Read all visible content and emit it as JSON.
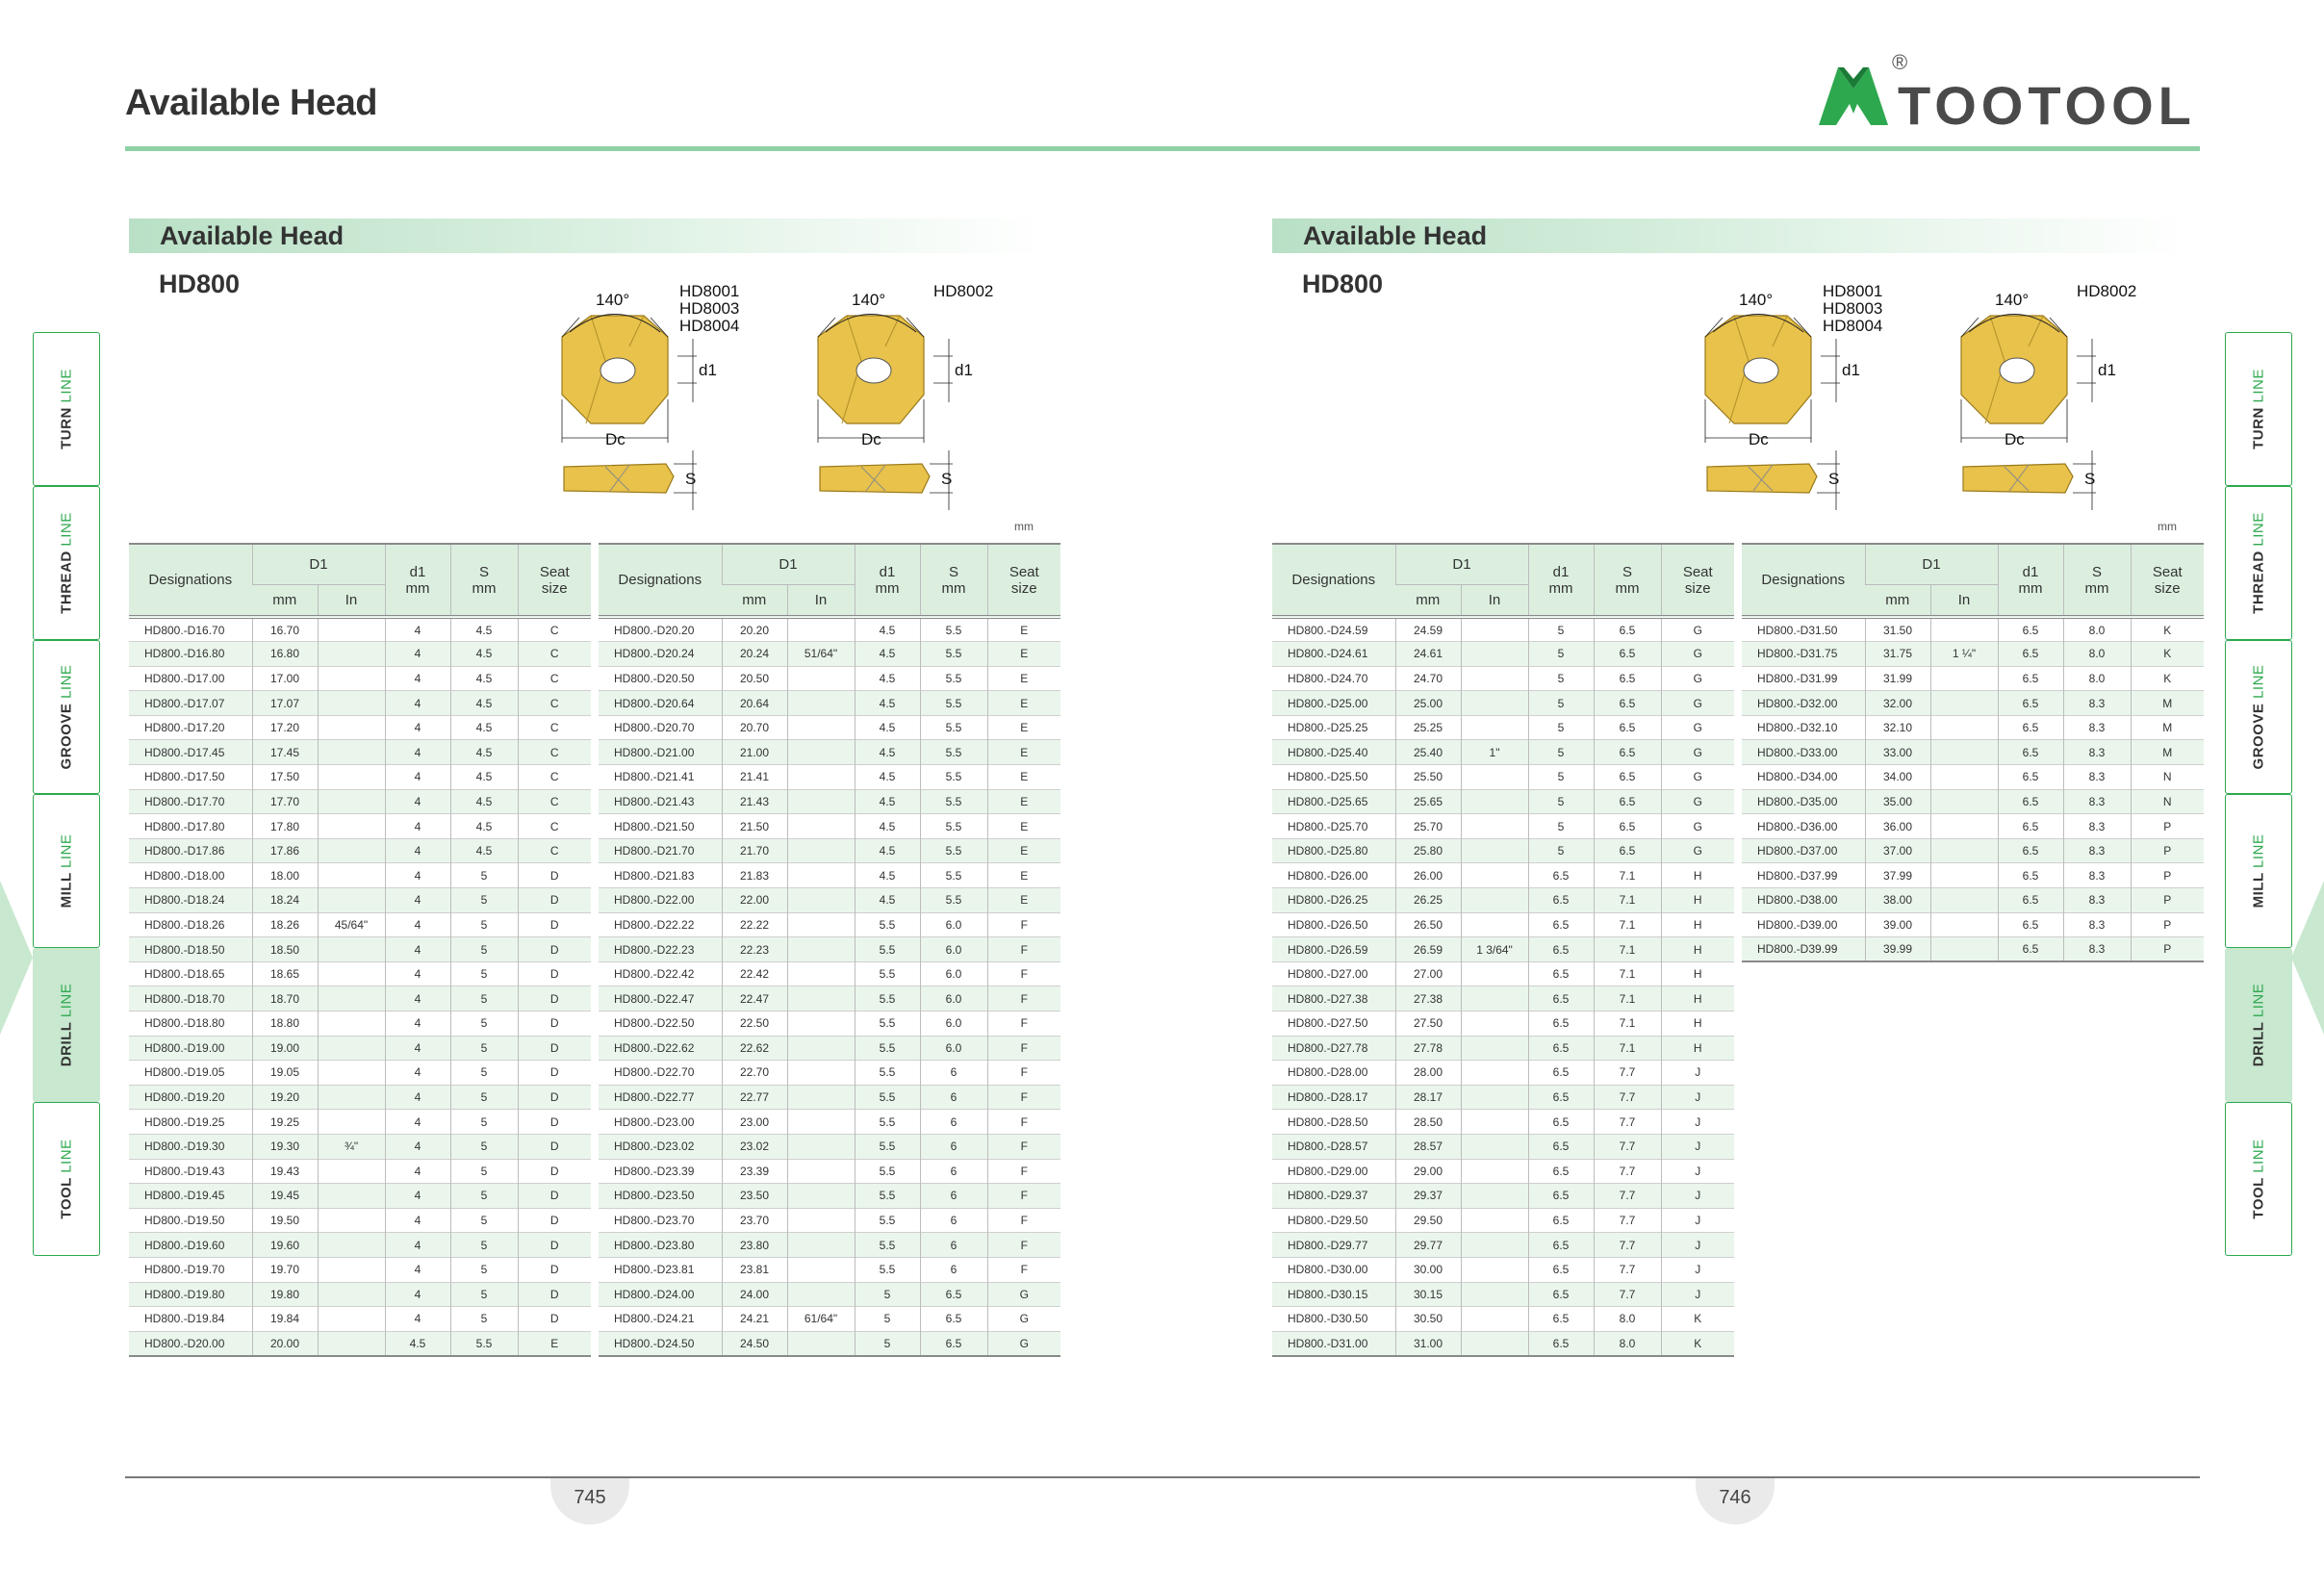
{
  "header": {
    "title": "Available Head",
    "brand": "TOOTOOL",
    "registered": "®"
  },
  "side_tabs": [
    {
      "main": "TURN",
      "sub": "LINE",
      "active": false
    },
    {
      "main": "THREAD",
      "sub": "LINE",
      "active": false
    },
    {
      "main": "GROOVE",
      "sub": "LINE",
      "active": false
    },
    {
      "main": "MILL",
      "sub": "LINE",
      "active": false
    },
    {
      "main": "DRILL",
      "sub": "LINE",
      "active": true
    },
    {
      "main": "TOOL",
      "sub": "LINE",
      "active": false
    }
  ],
  "figure": {
    "angle": "140°",
    "captions_a": [
      "HD8001",
      "HD8003",
      "HD8004"
    ],
    "caption_b": "HD8002",
    "label_d1": "d1",
    "label_dc": "Dc",
    "label_s": "S"
  },
  "table_headers": {
    "designations": "Designations",
    "d1_group": "D1",
    "mm": "mm",
    "in": "In",
    "d1": "d1",
    "d1_unit": "mm",
    "s": "S",
    "s_unit": "mm",
    "seat": "Seat",
    "seat2": "size"
  },
  "pages": [
    {
      "banner": "Available Head",
      "series": "HD800",
      "unit_note": "mm",
      "page_number": "745",
      "tables": [
        {
          "rows": [
            [
              "HD800.-D16.70",
              "16.70",
              "",
              "4",
              "4.5",
              "C"
            ],
            [
              "HD800.-D16.80",
              "16.80",
              "",
              "4",
              "4.5",
              "C"
            ],
            [
              "HD800.-D17.00",
              "17.00",
              "",
              "4",
              "4.5",
              "C"
            ],
            [
              "HD800.-D17.07",
              "17.07",
              "",
              "4",
              "4.5",
              "C"
            ],
            [
              "HD800.-D17.20",
              "17.20",
              "",
              "4",
              "4.5",
              "C"
            ],
            [
              "HD800.-D17.45",
              "17.45",
              "",
              "4",
              "4.5",
              "C"
            ],
            [
              "HD800.-D17.50",
              "17.50",
              "",
              "4",
              "4.5",
              "C"
            ],
            [
              "HD800.-D17.70",
              "17.70",
              "",
              "4",
              "4.5",
              "C"
            ],
            [
              "HD800.-D17.80",
              "17.80",
              "",
              "4",
              "4.5",
              "C"
            ],
            [
              "HD800.-D17.86",
              "17.86",
              "",
              "4",
              "4.5",
              "C"
            ],
            [
              "HD800.-D18.00",
              "18.00",
              "",
              "4",
              "5",
              "D"
            ],
            [
              "HD800.-D18.24",
              "18.24",
              "",
              "4",
              "5",
              "D"
            ],
            [
              "HD800.-D18.26",
              "18.26",
              "45/64\"",
              "4",
              "5",
              "D"
            ],
            [
              "HD800.-D18.50",
              "18.50",
              "",
              "4",
              "5",
              "D"
            ],
            [
              "HD800.-D18.65",
              "18.65",
              "",
              "4",
              "5",
              "D"
            ],
            [
              "HD800.-D18.70",
              "18.70",
              "",
              "4",
              "5",
              "D"
            ],
            [
              "HD800.-D18.80",
              "18.80",
              "",
              "4",
              "5",
              "D"
            ],
            [
              "HD800.-D19.00",
              "19.00",
              "",
              "4",
              "5",
              "D"
            ],
            [
              "HD800.-D19.05",
              "19.05",
              "",
              "4",
              "5",
              "D"
            ],
            [
              "HD800.-D19.20",
              "19.20",
              "",
              "4",
              "5",
              "D"
            ],
            [
              "HD800.-D19.25",
              "19.25",
              "",
              "4",
              "5",
              "D"
            ],
            [
              "HD800.-D19.30",
              "19.30",
              "¾\"",
              "4",
              "5",
              "D"
            ],
            [
              "HD800.-D19.43",
              "19.43",
              "",
              "4",
              "5",
              "D"
            ],
            [
              "HD800.-D19.45",
              "19.45",
              "",
              "4",
              "5",
              "D"
            ],
            [
              "HD800.-D19.50",
              "19.50",
              "",
              "4",
              "5",
              "D"
            ],
            [
              "HD800.-D19.60",
              "19.60",
              "",
              "4",
              "5",
              "D"
            ],
            [
              "HD800.-D19.70",
              "19.70",
              "",
              "4",
              "5",
              "D"
            ],
            [
              "HD800.-D19.80",
              "19.80",
              "",
              "4",
              "5",
              "D"
            ],
            [
              "HD800.-D19.84",
              "19.84",
              "",
              "4",
              "5",
              "D"
            ],
            [
              "HD800.-D20.00",
              "20.00",
              "",
              "4.5",
              "5.5",
              "E"
            ]
          ]
        },
        {
          "rows": [
            [
              "HD800.-D20.20",
              "20.20",
              "",
              "4.5",
              "5.5",
              "E"
            ],
            [
              "HD800.-D20.24",
              "20.24",
              "51/64\"",
              "4.5",
              "5.5",
              "E"
            ],
            [
              "HD800.-D20.50",
              "20.50",
              "",
              "4.5",
              "5.5",
              "E"
            ],
            [
              "HD800.-D20.64",
              "20.64",
              "",
              "4.5",
              "5.5",
              "E"
            ],
            [
              "HD800.-D20.70",
              "20.70",
              "",
              "4.5",
              "5.5",
              "E"
            ],
            [
              "HD800.-D21.00",
              "21.00",
              "",
              "4.5",
              "5.5",
              "E"
            ],
            [
              "HD800.-D21.41",
              "21.41",
              "",
              "4.5",
              "5.5",
              "E"
            ],
            [
              "HD800.-D21.43",
              "21.43",
              "",
              "4.5",
              "5.5",
              "E"
            ],
            [
              "HD800.-D21.50",
              "21.50",
              "",
              "4.5",
              "5.5",
              "E"
            ],
            [
              "HD800.-D21.70",
              "21.70",
              "",
              "4.5",
              "5.5",
              "E"
            ],
            [
              "HD800.-D21.83",
              "21.83",
              "",
              "4.5",
              "5.5",
              "E"
            ],
            [
              "HD800.-D22.00",
              "22.00",
              "",
              "4.5",
              "5.5",
              "E"
            ],
            [
              "HD800.-D22.22",
              "22.22",
              "",
              "5.5",
              "6.0",
              "F"
            ],
            [
              "HD800.-D22.23",
              "22.23",
              "",
              "5.5",
              "6.0",
              "F"
            ],
            [
              "HD800.-D22.42",
              "22.42",
              "",
              "5.5",
              "6.0",
              "F"
            ],
            [
              "HD800.-D22.47",
              "22.47",
              "",
              "5.5",
              "6.0",
              "F"
            ],
            [
              "HD800.-D22.50",
              "22.50",
              "",
              "5.5",
              "6.0",
              "F"
            ],
            [
              "HD800.-D22.62",
              "22.62",
              "",
              "5.5",
              "6.0",
              "F"
            ],
            [
              "HD800.-D22.70",
              "22.70",
              "",
              "5.5",
              "6",
              "F"
            ],
            [
              "HD800.-D22.77",
              "22.77",
              "",
              "5.5",
              "6",
              "F"
            ],
            [
              "HD800.-D23.00",
              "23.00",
              "",
              "5.5",
              "6",
              "F"
            ],
            [
              "HD800.-D23.02",
              "23.02",
              "",
              "5.5",
              "6",
              "F"
            ],
            [
              "HD800.-D23.39",
              "23.39",
              "",
              "5.5",
              "6",
              "F"
            ],
            [
              "HD800.-D23.50",
              "23.50",
              "",
              "5.5",
              "6",
              "F"
            ],
            [
              "HD800.-D23.70",
              "23.70",
              "",
              "5.5",
              "6",
              "F"
            ],
            [
              "HD800.-D23.80",
              "23.80",
              "",
              "5.5",
              "6",
              "F"
            ],
            [
              "HD800.-D23.81",
              "23.81",
              "",
              "5.5",
              "6",
              "F"
            ],
            [
              "HD800.-D24.00",
              "24.00",
              "",
              "5",
              "6.5",
              "G"
            ],
            [
              "HD800.-D24.21",
              "24.21",
              "61/64\"",
              "5",
              "6.5",
              "G"
            ],
            [
              "HD800.-D24.50",
              "24.50",
              "",
              "5",
              "6.5",
              "G"
            ]
          ]
        }
      ]
    },
    {
      "banner": "Available Head",
      "series": "HD800",
      "unit_note": "mm",
      "page_number": "746",
      "tables": [
        {
          "rows": [
            [
              "HD800.-D24.59",
              "24.59",
              "",
              "5",
              "6.5",
              "G"
            ],
            [
              "HD800.-D24.61",
              "24.61",
              "",
              "5",
              "6.5",
              "G"
            ],
            [
              "HD800.-D24.70",
              "24.70",
              "",
              "5",
              "6.5",
              "G"
            ],
            [
              "HD800.-D25.00",
              "25.00",
              "",
              "5",
              "6.5",
              "G"
            ],
            [
              "HD800.-D25.25",
              "25.25",
              "",
              "5",
              "6.5",
              "G"
            ],
            [
              "HD800.-D25.40",
              "25.40",
              "1\"",
              "5",
              "6.5",
              "G"
            ],
            [
              "HD800.-D25.50",
              "25.50",
              "",
              "5",
              "6.5",
              "G"
            ],
            [
              "HD800.-D25.65",
              "25.65",
              "",
              "5",
              "6.5",
              "G"
            ],
            [
              "HD800.-D25.70",
              "25.70",
              "",
              "5",
              "6.5",
              "G"
            ],
            [
              "HD800.-D25.80",
              "25.80",
              "",
              "5",
              "6.5",
              "G"
            ],
            [
              "HD800.-D26.00",
              "26.00",
              "",
              "6.5",
              "7.1",
              "H"
            ],
            [
              "HD800.-D26.25",
              "26.25",
              "",
              "6.5",
              "7.1",
              "H"
            ],
            [
              "HD800.-D26.50",
              "26.50",
              "",
              "6.5",
              "7.1",
              "H"
            ],
            [
              "HD800.-D26.59",
              "26.59",
              "1 3/64\"",
              "6.5",
              "7.1",
              "H"
            ],
            [
              "HD800.-D27.00",
              "27.00",
              "",
              "6.5",
              "7.1",
              "H"
            ],
            [
              "HD800.-D27.38",
              "27.38",
              "",
              "6.5",
              "7.1",
              "H"
            ],
            [
              "HD800.-D27.50",
              "27.50",
              "",
              "6.5",
              "7.1",
              "H"
            ],
            [
              "HD800.-D27.78",
              "27.78",
              "",
              "6.5",
              "7.1",
              "H"
            ],
            [
              "HD800.-D28.00",
              "28.00",
              "",
              "6.5",
              "7.7",
              "J"
            ],
            [
              "HD800.-D28.17",
              "28.17",
              "",
              "6.5",
              "7.7",
              "J"
            ],
            [
              "HD800.-D28.50",
              "28.50",
              "",
              "6.5",
              "7.7",
              "J"
            ],
            [
              "HD800.-D28.57",
              "28.57",
              "",
              "6.5",
              "7.7",
              "J"
            ],
            [
              "HD800.-D29.00",
              "29.00",
              "",
              "6.5",
              "7.7",
              "J"
            ],
            [
              "HD800.-D29.37",
              "29.37",
              "",
              "6.5",
              "7.7",
              "J"
            ],
            [
              "HD800.-D29.50",
              "29.50",
              "",
              "6.5",
              "7.7",
              "J"
            ],
            [
              "HD800.-D29.77",
              "29.77",
              "",
              "6.5",
              "7.7",
              "J"
            ],
            [
              "HD800.-D30.00",
              "30.00",
              "",
              "6.5",
              "7.7",
              "J"
            ],
            [
              "HD800.-D30.15",
              "30.15",
              "",
              "6.5",
              "7.7",
              "J"
            ],
            [
              "HD800.-D30.50",
              "30.50",
              "",
              "6.5",
              "8.0",
              "K"
            ],
            [
              "HD800.-D31.00",
              "31.00",
              "",
              "6.5",
              "8.0",
              "K"
            ]
          ]
        },
        {
          "rows": [
            [
              "HD800.-D31.50",
              "31.50",
              "",
              "6.5",
              "8.0",
              "K"
            ],
            [
              "HD800.-D31.75",
              "31.75",
              "1 ¼\"",
              "6.5",
              "8.0",
              "K"
            ],
            [
              "HD800.-D31.99",
              "31.99",
              "",
              "6.5",
              "8.0",
              "K"
            ],
            [
              "HD800.-D32.00",
              "32.00",
              "",
              "6.5",
              "8.3",
              "M"
            ],
            [
              "HD800.-D32.10",
              "32.10",
              "",
              "6.5",
              "8.3",
              "M"
            ],
            [
              "HD800.-D33.00",
              "33.00",
              "",
              "6.5",
              "8.3",
              "M"
            ],
            [
              "HD800.-D34.00",
              "34.00",
              "",
              "6.5",
              "8.3",
              "N"
            ],
            [
              "HD800.-D35.00",
              "35.00",
              "",
              "6.5",
              "8.3",
              "N"
            ],
            [
              "HD800.-D36.00",
              "36.00",
              "",
              "6.5",
              "8.3",
              "P"
            ],
            [
              "HD800.-D37.00",
              "37.00",
              "",
              "6.5",
              "8.3",
              "P"
            ],
            [
              "HD800.-D37.99",
              "37.99",
              "",
              "6.5",
              "8.3",
              "P"
            ],
            [
              "HD800.-D38.00",
              "38.00",
              "",
              "6.5",
              "8.3",
              "P"
            ],
            [
              "HD800.-D39.00",
              "39.00",
              "",
              "6.5",
              "8.3",
              "P"
            ],
            [
              "HD800.-D39.99",
              "39.99",
              "",
              "6.5",
              "8.3",
              "P"
            ]
          ]
        }
      ]
    }
  ],
  "colors": {
    "accent_green": "#2ea84f",
    "header_green": "#dcefdf",
    "row_stripe": "#eaf6ec",
    "insert_gold": "#e8c24a"
  }
}
